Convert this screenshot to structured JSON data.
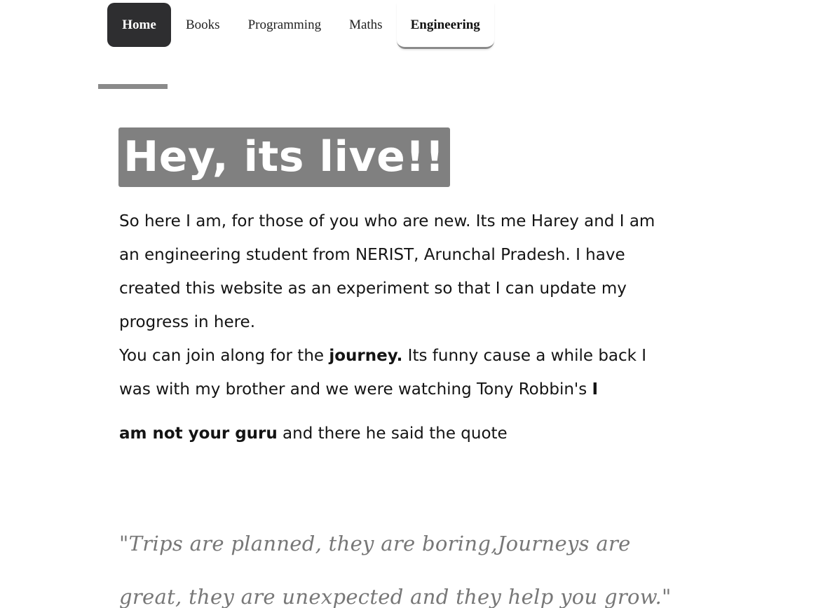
{
  "nav": {
    "items": [
      {
        "label": "Home"
      },
      {
        "label": "Books"
      },
      {
        "label": "Programming"
      },
      {
        "label": "Maths"
      },
      {
        "label": "Engineering"
      }
    ]
  },
  "colors": {
    "nav_active_bg": "#2e2e30",
    "headline_bg": "#808080",
    "accent": "#8a8a8a",
    "quote_text": "#777777"
  },
  "post": {
    "title": "Hey, its live!!",
    "para1": "So here I am, for those of you who are new. Its me Harey and I am an engineering student from NERIST, Arunchal Pradesh. I have created this website as an experiment so that I can update my progress in here.",
    "para2": {
      "part1": "You can join along for the ",
      "bold1": "journey.",
      "part2": " Its funny cause a while back I was with my brother and we were watching Tony Robbin's ",
      "bold2": "I",
      "bold3": "am not your guru",
      "part3": " and there he said the quote"
    },
    "quote": "\"Trips are planned, they are boring,Journeys are great, they are unexpected and they help you grow.\""
  }
}
